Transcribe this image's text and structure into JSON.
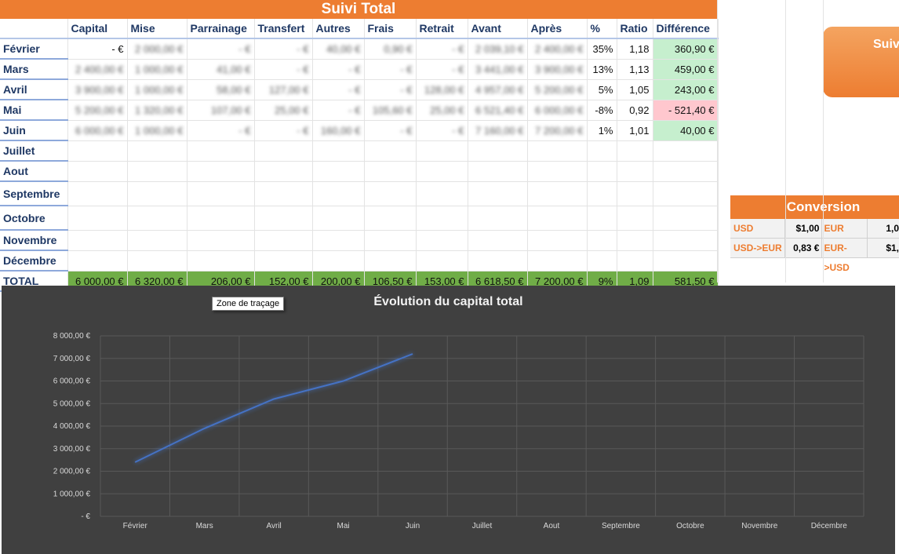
{
  "sheet": {
    "title": "Suivi Total",
    "columns": [
      "Capital",
      "Mise",
      "Parrainage",
      "Transfert",
      "Autres",
      "Frais",
      "Retrait",
      "Avant",
      "Après",
      "%",
      "Ratio",
      "Différence"
    ],
    "rows": [
      {
        "month": "Février",
        "capital": "-   €",
        "mise": "2 000,00 €",
        "parrainage": "-   €",
        "transfert": "-   €",
        "autres": "40,00 €",
        "frais": "0,90 €",
        "retrait": "-   €",
        "avant": "2 039,10 €",
        "apres": "2 400,00 €",
        "pct": "35%",
        "ratio": "1,18",
        "diff": "360,90 €",
        "diff_state": "pos"
      },
      {
        "month": "Mars",
        "capital": "2 400,00 €",
        "mise": "1 000,00 €",
        "parrainage": "41,00 €",
        "transfert": "-   €",
        "autres": "-   €",
        "frais": "-   €",
        "retrait": "-   €",
        "avant": "3 441,00 €",
        "apres": "3 900,00 €",
        "pct": "13%",
        "ratio": "1,13",
        "diff": "459,00 €",
        "diff_state": "pos"
      },
      {
        "month": "Avril",
        "capital": "3 900,00 €",
        "mise": "1 000,00 €",
        "parrainage": "58,00 €",
        "transfert": "127,00 €",
        "autres": "-   €",
        "frais": "-   €",
        "retrait": "128,00 €",
        "avant": "4 957,00 €",
        "apres": "5 200,00 €",
        "pct": "5%",
        "ratio": "1,05",
        "diff": "243,00 €",
        "diff_state": "pos"
      },
      {
        "month": "Mai",
        "capital": "5 200,00 €",
        "mise": "1 320,00 €",
        "parrainage": "107,00 €",
        "transfert": "25,00 €",
        "autres": "-   €",
        "frais": "105,60 €",
        "retrait": "25,00 €",
        "avant": "6 521,40 €",
        "apres": "6 000,00 €",
        "pct": "-8%",
        "ratio": "0,92",
        "diff": "-     521,40 €",
        "diff_state": "neg"
      },
      {
        "month": "Juin",
        "capital": "6 000,00 €",
        "mise": "1 000,00 €",
        "parrainage": "-   €",
        "transfert": "-   €",
        "autres": "160,00 €",
        "frais": "-   €",
        "retrait": "-   €",
        "avant": "7 160,00 €",
        "apres": "7 200,00 €",
        "pct": "1%",
        "ratio": "1,01",
        "diff": "40,00 €",
        "diff_state": "pos"
      },
      {
        "month": "Juillet"
      },
      {
        "month": "Aout"
      },
      {
        "month": "Septembre"
      },
      {
        "month": "Octobre"
      },
      {
        "month": "Novembre"
      },
      {
        "month": "Décembre"
      }
    ],
    "total": {
      "label": "TOTAL",
      "capital": "6 000,00 €",
      "mise": "6 320,00 €",
      "parrainage": "206,00 €",
      "transfert": "152,00 €",
      "autres": "200,00 €",
      "frais": "106,50 €",
      "retrait": "153,00 €",
      "avant": "6 618,50 €",
      "apres": "7 200,00 €",
      "pct": "9%",
      "ratio": "1,09",
      "diff": "581,50 €"
    }
  },
  "side_box": {
    "label": "Suiv"
  },
  "conversion": {
    "title": "Conversion",
    "rows": [
      {
        "label1": "USD",
        "value1": "$1,00",
        "label2": "EUR",
        "value2": "1,0"
      },
      {
        "label1": "USD->EUR",
        "value1": "0,83 €",
        "label2": "EUR->USD",
        "value2": "$1,"
      }
    ]
  },
  "colors": {
    "accent": "#ED7D31",
    "total_green": "#70AD47",
    "line": "#4472C4",
    "chart_bg": "#404040"
  },
  "tooltip": "Zone de traçage",
  "chart_data": {
    "type": "line",
    "title": "Évolution du capital total",
    "categories": [
      "Février",
      "Mars",
      "Avril",
      "Mai",
      "Juin",
      "Juillet",
      "Aout",
      "Septembre",
      "Octobre",
      "Novembre",
      "Décembre"
    ],
    "series": [
      {
        "values": [
          2400,
          3900,
          5200,
          6000,
          7200,
          null,
          null,
          null,
          null,
          null,
          null
        ]
      }
    ],
    "yticks": [
      "-   €",
      "1 000,00 €",
      "2 000,00 €",
      "3 000,00 €",
      "4 000,00 €",
      "5 000,00 €",
      "6 000,00 €",
      "7 000,00 €",
      "8 000,00 €"
    ],
    "ylim": [
      0,
      8000
    ],
    "grid": true
  }
}
